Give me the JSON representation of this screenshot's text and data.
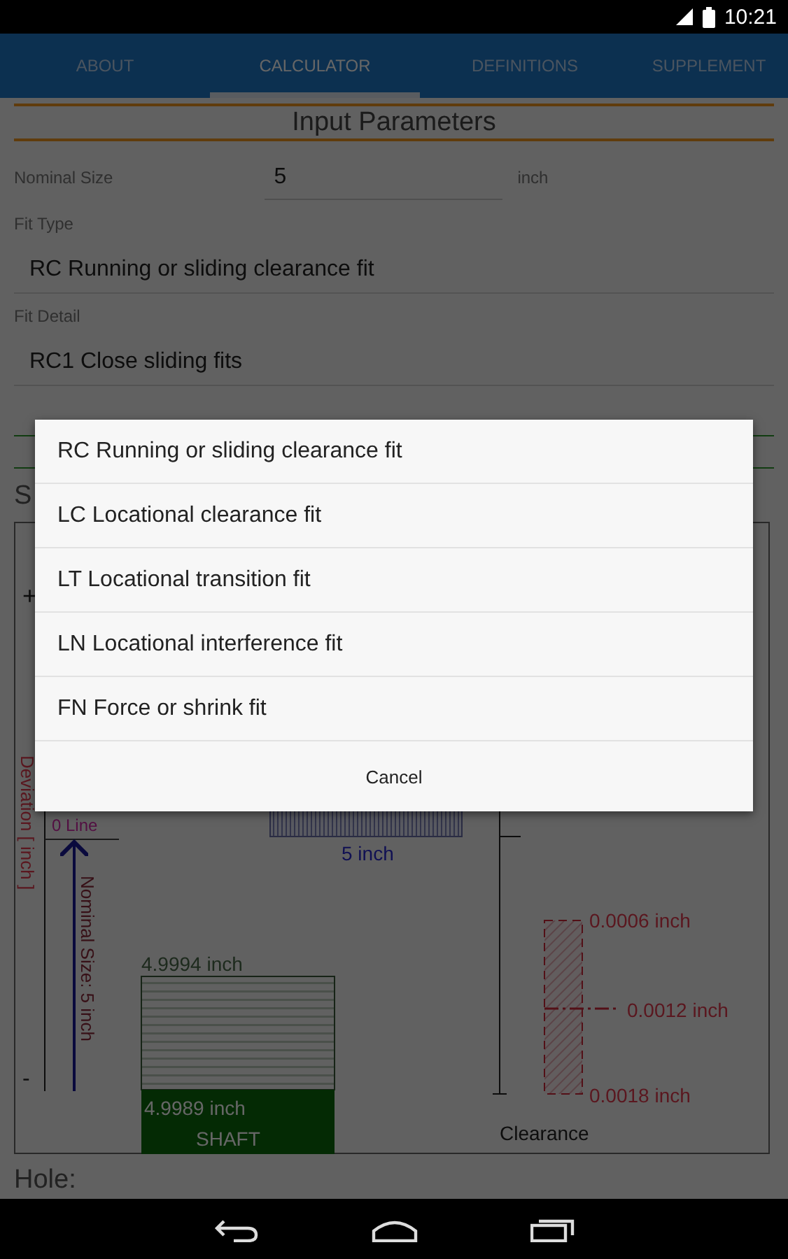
{
  "status_bar": {
    "time": "10:21"
  },
  "tabs": [
    {
      "label": "ABOUT",
      "selected": false
    },
    {
      "label": "CALCULATOR",
      "selected": true
    },
    {
      "label": "DEFINITIONS",
      "selected": false
    },
    {
      "label": "SUPPLEMENT",
      "selected": false
    }
  ],
  "input_parameters": {
    "title": "Input Parameters",
    "nominal_size": {
      "label": "Nominal Size",
      "value": "5",
      "unit": "inch"
    },
    "fit_type": {
      "label": "Fit Type",
      "value": "RC Running or sliding clearance fit"
    },
    "fit_detail": {
      "label": "Fit Detail",
      "value": "RC1 Close sliding fits"
    }
  },
  "section_heading": "S",
  "diagram": {
    "plus": "+",
    "minus": "-",
    "axis_title": "Deviation [ inch ]",
    "zero_line": "0 Line",
    "nominal_label": "Nominal Size: 5 inch",
    "hole_size": "5 inch",
    "shaft_upper": "4.9994 inch",
    "shaft_lower": "4.9989 inch",
    "shaft_label": "SHAFT",
    "clearance_values": [
      "0.0006 inch",
      "0.0012 inch",
      "0.0018 inch"
    ],
    "clearance_title": "Clearance"
  },
  "next_section": "Hole:",
  "dialog": {
    "options": [
      {
        "label": "RC Running or sliding clearance fit"
      },
      {
        "label": "LC Locational clearance fit"
      },
      {
        "label": "LT Locational transition fit"
      },
      {
        "label": "LN Locational interference fit"
      },
      {
        "label": "FN Force or shrink fit"
      }
    ],
    "cancel": "Cancel"
  }
}
